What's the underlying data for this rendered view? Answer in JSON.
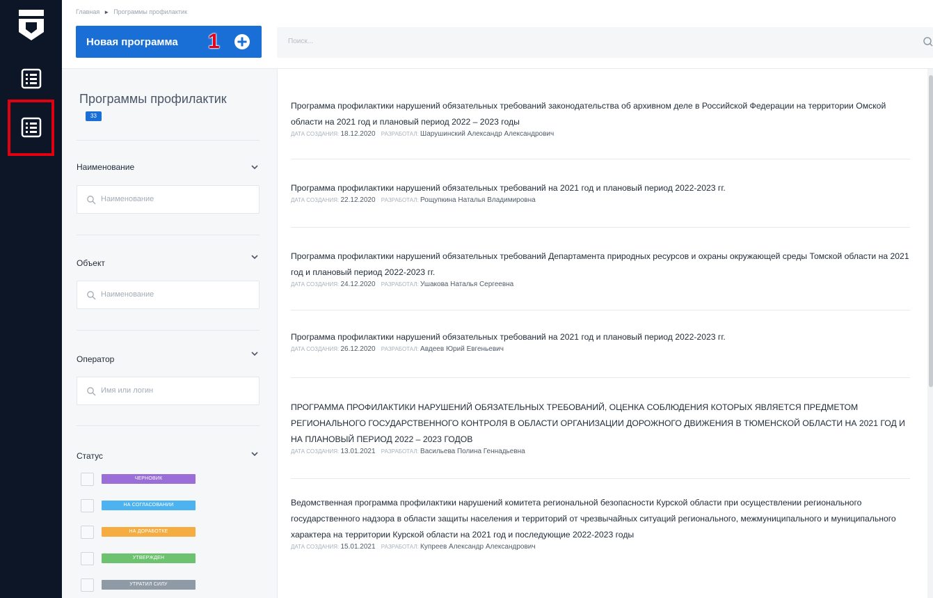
{
  "header": {
    "breadcrumb": [
      "Главная",
      "Программы профилактик"
    ],
    "new_button_label": "Новая программа",
    "annotation_number": "1",
    "search_placeholder": "Поиск..."
  },
  "sidebar": {
    "items": [
      {
        "icon": "list-icon",
        "active": false
      },
      {
        "icon": "list-icon",
        "active": true
      }
    ]
  },
  "filters": {
    "title": "Программы профилактик",
    "count": "33",
    "name_label": "Наименование",
    "name_placeholder": "Наименование",
    "object_label": "Объект",
    "object_placeholder": "Наименование",
    "operator_label": "Оператор",
    "operator_placeholder": "Имя или логин",
    "status_label": "Статус",
    "statuses": [
      {
        "label": "ЧЕРНОВИК",
        "color": "#9b6dd6"
      },
      {
        "label": "НА СОГЛАСОВАНИИ",
        "color": "#4cb3f0"
      },
      {
        "label": "НА ДОРАБОТКЕ",
        "color": "#f5ad42"
      },
      {
        "label": "УТВЕРЖДЕН",
        "color": "#6cc26e"
      },
      {
        "label": "УТРАТИЛ СИЛУ",
        "color": "#8e9aa6"
      }
    ]
  },
  "meta_labels": {
    "created": "ДАТА СОЗДАНИЯ:",
    "author": "РАЗРАБОТАЛ:"
  },
  "programs": [
    {
      "title": "Программа профилактики нарушений обязательных требований законодательства об архивном деле в Российской Федерации на территории Омской области на 2021 год и плановый период 2022 – 2023 годы",
      "date": "18.12.2020",
      "author": "Шарушинский Александр Александрович"
    },
    {
      "title": "Программа профилактики нарушений обязательных требований на 2021 год и плановый период 2022-2023 гг.",
      "date": "22.12.2020",
      "author": "Рощупкина Наталья Владимировна"
    },
    {
      "title": "Программа профилактики нарушений обязательных требований Департамента природных ресурсов и охраны окружающей среды Томской области на 2021 год и плановый период 2022-2023 гг.",
      "date": "24.12.2020",
      "author": "Ушакова Наталья Сергеевна"
    },
    {
      "title": "Программа профилактики нарушений обязательных требований на 2021 год и плановый период 2022-2023 гг.",
      "date": "26.12.2020",
      "author": "Авдеев Юрий Евгеньевич"
    },
    {
      "title": "ПРОГРАММА ПРОФИЛАКТИКИ НАРУШЕНИЙ ОБЯЗАТЕЛЬНЫХ ТРЕБОВАНИЙ, ОЦЕНКА СОБЛЮДЕНИЯ КОТОРЫХ ЯВЛЯЕТСЯ ПРЕДМЕТОМ РЕГИОНАЛЬНОГО ГОСУДАРСТВЕННОГО КОНТРОЛЯ В ОБЛАСТИ ОРГАНИЗАЦИИ ДОРОЖНОГО ДВИЖЕНИЯ В ТЮМЕНСКОЙ ОБЛАСТИ НА 2021 ГОД И НА ПЛАНОВЫЙ ПЕРИОД 2022 – 2023 ГОДОВ",
      "date": "13.01.2021",
      "author": "Васильева Полина Геннадьевна"
    },
    {
      "title": "Ведомственная программа профилактики нарушений комитета региональной безопасности Курской области при осуществлении регионального государственного надзора в области защиты населения и территорий от чрезвычайных ситуаций регионального, межмуниципального и муниципального характера на территории Курской области на 2021 год и последующие 2022-2023 годы",
      "date": "15.01.2021",
      "author": "Купреев Александр Александрович"
    }
  ]
}
